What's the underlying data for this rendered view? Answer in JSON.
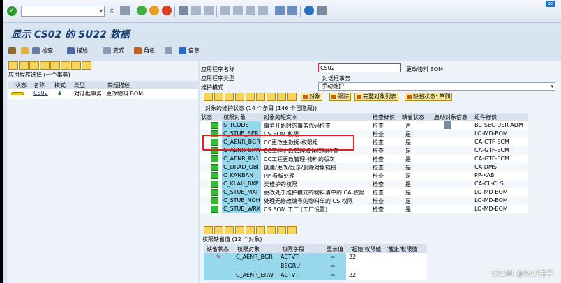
{
  "window": {
    "title": "显示 CS02 的 SU22 数据",
    "close_label": "oo"
  },
  "appbar": {
    "check": "检查",
    "describe": "描述",
    "variant": "变式",
    "role": "角色",
    "info": "信息"
  },
  "left_panel": {
    "caption": "应用程序选择 (一个事务)",
    "headers": [
      "状态",
      "名称",
      "模式",
      "类型",
      "简短描述"
    ],
    "row": {
      "name": "CS02",
      "type": "对话框事务",
      "description": "更改物料 BOM"
    }
  },
  "form": {
    "app_name_label": "应用程序名称",
    "app_name_value": "CS02",
    "app_name_desc": "更改物料 BOM",
    "app_type_label": "应用程序类型",
    "app_type_value": "对话框事务",
    "maint_mode_label": "维护模式",
    "maint_mode_value": "手动维护"
  },
  "grid_toolbar": {
    "object_btn": "对象",
    "trace_btn": "跟踪",
    "complete_list_btn": "完整对象列表",
    "missing_status_btn": "缺省状态: 单列"
  },
  "grid": {
    "caption": "对象的维护状态 (14 个条目 (146 个已隐藏))",
    "headers": {
      "status": "状态",
      "object": "权限对象",
      "text": "对象的短文本",
      "check": "检查标识",
      "default_status": "缺省状态",
      "start_info": "启动对象信息",
      "component": "组件标识"
    },
    "rows": [
      {
        "object": "S_TCODE",
        "text": "事务开始时的事务代码检查",
        "check": "检查",
        "default": "否",
        "component": "BC-SEC-USR-ADM"
      },
      {
        "object": "C_STUE_BER",
        "text": "CS BOM 权限",
        "check": "检查",
        "default": "是",
        "component": "LO-MD-BOM"
      },
      {
        "object": "C_AENR_BGR",
        "text": "CC更改主数据-权限组",
        "check": "检查",
        "default": "是",
        "component": "CA-GTF-ECM"
      },
      {
        "object": "C_AENR_ERW",
        "text": "CC工程更改管理增强权限检查",
        "check": "检查",
        "default": "是",
        "component": "CA-GTF-ECM"
      },
      {
        "object": "C_AENR_RV1",
        "text": "CC工程更改管理-物料的版次",
        "check": "检查",
        "default": "是",
        "component": "CA-GTF-ECM"
      },
      {
        "object": "C_DRAD_OBJ",
        "text": "创建/更改/显示/删除对象链接",
        "check": "检查",
        "default": "是",
        "component": "CA-DMS"
      },
      {
        "object": "C_KANBAN",
        "text": "PP 看板处理",
        "check": "检查",
        "default": "是",
        "component": "PP-KAB"
      },
      {
        "object": "C_KLAH_BKP",
        "text": "类维护的权限",
        "check": "检查",
        "default": "是",
        "component": "CA-CL-CLS"
      },
      {
        "object": "C_STUE_MAI",
        "text": "更改处于维护模式的物料清单的 CA 权限",
        "check": "检查",
        "default": "是",
        "component": "LO-MD-BOM"
      },
      {
        "object": "C_STUE_NOH",
        "text": "处理无修改编号的物料单的 CS 权限",
        "check": "检查",
        "default": "是",
        "component": "LO-MD-BOM"
      },
      {
        "object": "C_STUE_WRK",
        "text": "CS BOM 工厂 (工厂设置)",
        "check": "检查",
        "default": "是",
        "component": "LO-MD-BOM"
      }
    ]
  },
  "lower": {
    "caption": "权限缺省值 (12 个对象)",
    "headers": [
      "缺省状态",
      "权限对象",
      "权限字段",
      "显示值",
      "'起始'权限值",
      "'截止'权限值"
    ],
    "rows": [
      {
        "object": "C_AENR_BGR",
        "field": "ACTVT",
        "from": "22"
      },
      {
        "object": "",
        "field": "BEGRU",
        "from": ""
      },
      {
        "object": "C_AENR_ERW",
        "field": "ACTVT",
        "from": "22"
      }
    ]
  },
  "watermark": "CSDN @SAP柱子"
}
